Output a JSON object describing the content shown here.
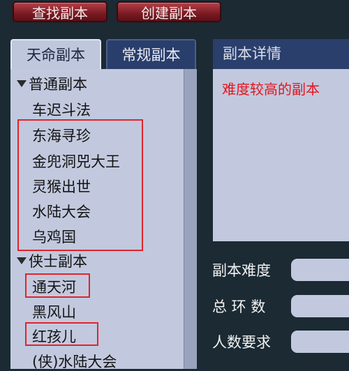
{
  "toolbar": {
    "search_label": "查找副本",
    "create_label": "创建副本"
  },
  "tabs": [
    {
      "label": "天命副本",
      "active": true
    },
    {
      "label": "常规副本",
      "active": false
    }
  ],
  "list": {
    "category1": "普通副本",
    "category1_items": [
      "车迟斗法",
      "东海寻珍",
      "金兜洞兕大王",
      "灵猴出世",
      "水陆大会",
      "乌鸡国"
    ],
    "category2": "侠士副本",
    "category2_items": [
      "通天河",
      "黑风山",
      "红孩儿",
      "(侠)水陆大会"
    ]
  },
  "detail": {
    "header": "副本详情",
    "description": "难度较高的副本"
  },
  "fields": {
    "difficulty_label": "副本难度",
    "difficulty_value": "",
    "rings_label": "总 环 数",
    "rings_value": "",
    "players_label": "人数要求",
    "players_value": ""
  },
  "colors": {
    "highlight": "#e0242c",
    "detail_text": "#e5161e"
  }
}
